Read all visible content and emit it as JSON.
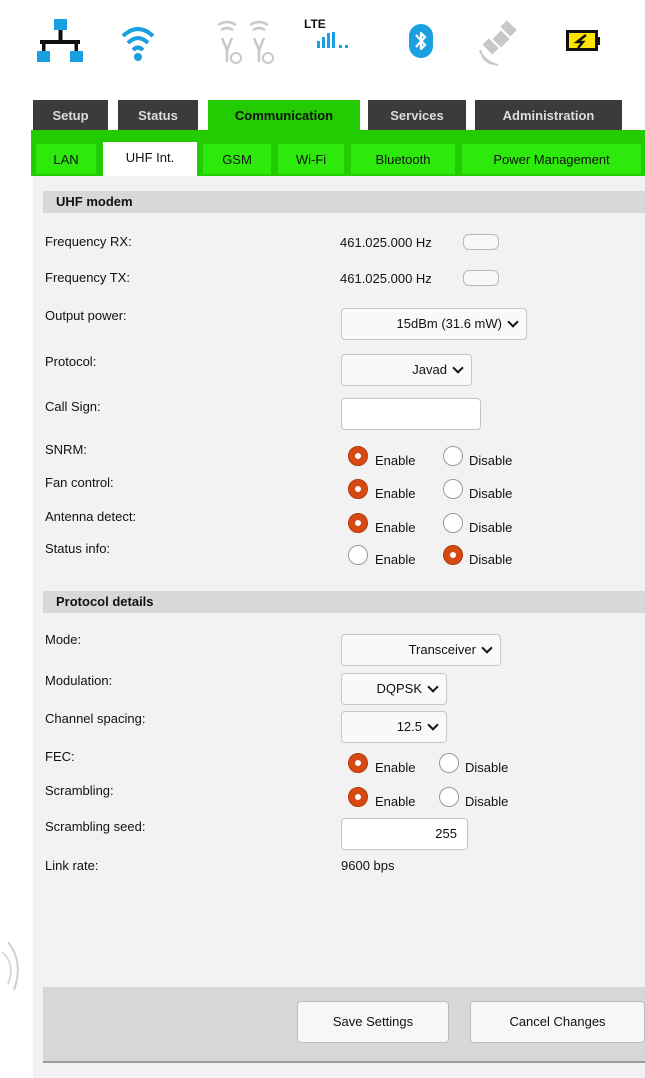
{
  "status_icons": [
    "network-icon",
    "wifi-icon",
    "dual-sim-icon",
    "lte-signal-icon",
    "bluetooth-icon",
    "satellite-icon",
    "battery-icon"
  ],
  "lte_label": "LTE",
  "colors": {
    "tab_active": "#22cc00",
    "tab_dark": "#3b3b3b",
    "radio_on": "#d64a12",
    "panel_bg": "#f2f2f2"
  },
  "main_tabs": [
    "Setup",
    "Status",
    "Communication",
    "Services",
    "Administration"
  ],
  "active_main_tab": "Communication",
  "sub_tabs": [
    "LAN",
    "UHF Int.",
    "GSM",
    "Wi-Fi",
    "Bluetooth",
    "Power Management"
  ],
  "active_sub_tab": "UHF Int.",
  "uhf": {
    "title": "UHF modem",
    "freq_rx_label": "Frequency RX:",
    "freq_rx": "461.025.000 Hz",
    "freq_tx_label": "Frequency TX:",
    "freq_tx": "461.025.000 Hz",
    "output_power_label": "Output power:",
    "output_power": "15dBm (31.6 mW)",
    "protocol_label": "Protocol:",
    "protocol": "Javad",
    "call_sign_label": "Call Sign:",
    "call_sign": "",
    "snrm_label": "SNRM:",
    "snrm": "Enable",
    "fan_label": "Fan control:",
    "fan": "Enable",
    "antenna_label": "Antenna detect:",
    "antenna": "Enable",
    "status_info_label": "Status info:",
    "status_info": "Disable"
  },
  "protocol": {
    "title": "Protocol details",
    "mode_label": "Mode:",
    "mode": "Transceiver",
    "modulation_label": "Modulation:",
    "modulation": "DQPSK",
    "spacing_label": "Channel spacing:",
    "spacing": "12.5",
    "fec_label": "FEC:",
    "fec": "Enable",
    "scrambling_label": "Scrambling:",
    "scrambling": "Enable",
    "seed_label": "Scrambling seed:",
    "seed": "255",
    "link_rate_label": "Link rate:",
    "link_rate": "9600 bps"
  },
  "radio_labels": {
    "enable": "Enable",
    "disable": "Disable"
  },
  "buttons": {
    "save": "Save Settings",
    "cancel": "Cancel Changes"
  }
}
